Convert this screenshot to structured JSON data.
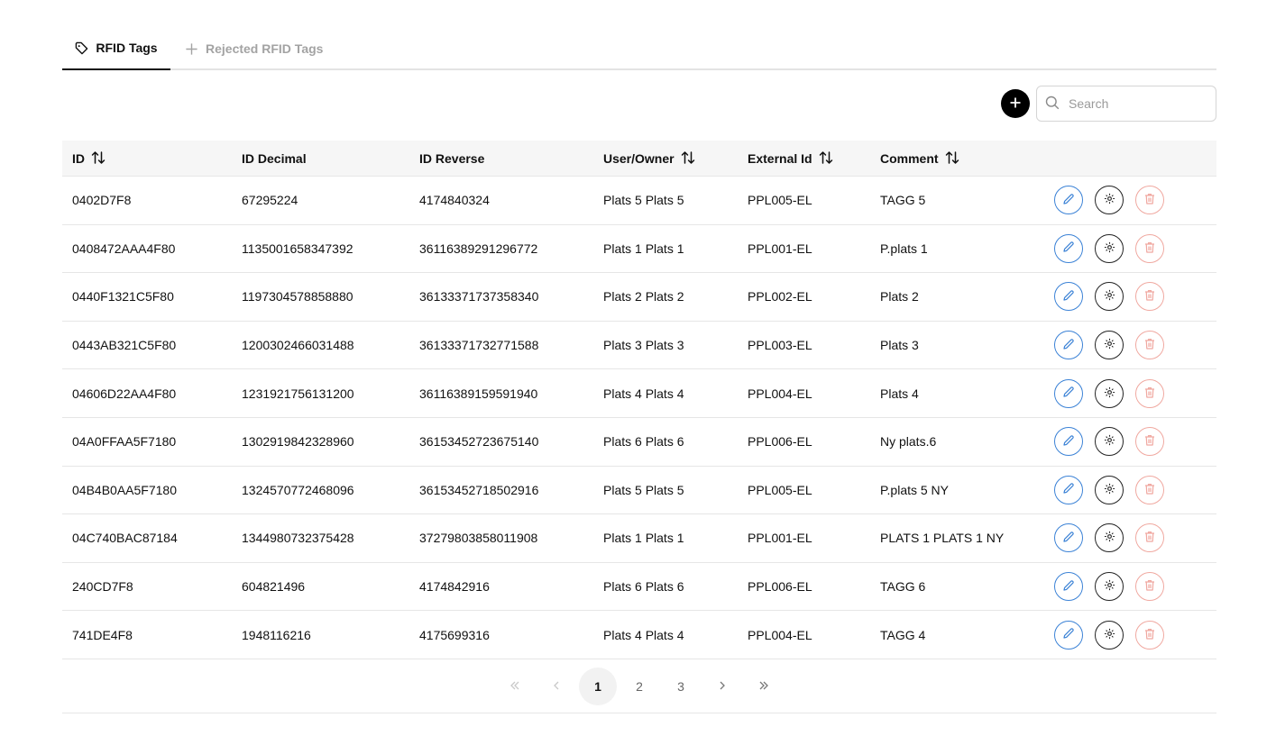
{
  "tabs": [
    {
      "label": "RFID Tags",
      "icon": "tag-icon"
    },
    {
      "label": "Rejected RFID Tags",
      "icon": "plus-icon"
    }
  ],
  "search": {
    "placeholder": "Search"
  },
  "table": {
    "headers": [
      "ID",
      "ID Decimal",
      "ID Reverse",
      "User/Owner",
      "External Id",
      "Comment"
    ],
    "rows": [
      [
        "0402D7F8",
        "67295224",
        "4174840324",
        "Plats 5 Plats 5",
        "PPL005-EL",
        "TAGG 5"
      ],
      [
        "0408472AAA4F80",
        "1135001658347392",
        "36116389291296772",
        "Plats 1 Plats 1",
        "PPL001-EL",
        "P.plats 1"
      ],
      [
        "0440F1321C5F80",
        "1197304578858880",
        "36133371737358340",
        "Plats 2 Plats 2",
        "PPL002-EL",
        "Plats 2"
      ],
      [
        "0443AB321C5F80",
        "1200302466031488",
        "36133371732771588",
        "Plats 3 Plats 3",
        "PPL003-EL",
        "Plats 3"
      ],
      [
        "04606D22AA4F80",
        "1231921756131200",
        "36116389159591940",
        "Plats 4 Plats 4",
        "PPL004-EL",
        "Plats 4"
      ],
      [
        "04A0FFAA5F7180",
        "1302919842328960",
        "36153452723675140",
        "Plats 6 Plats 6",
        "PPL006-EL",
        "Ny plats.6"
      ],
      [
        "04B4B0AA5F7180",
        "1324570772468096",
        "36153452718502916",
        "Plats 5 Plats 5",
        "PPL005-EL",
        "P.plats 5 NY"
      ],
      [
        "04C740BAC87184",
        "1344980732375428",
        "37279803858011908",
        "Plats 1 Plats 1",
        "PPL001-EL",
        "PLATS 1 PLATS 1 NY"
      ],
      [
        "240CD7F8",
        "604821496",
        "4174842916",
        "Plats 6 Plats 6",
        "PPL006-EL",
        "TAGG 6"
      ],
      [
        "741DE4F8",
        "1948116216",
        "4175699316",
        "Plats 4 Plats 4",
        "PPL004-EL",
        "TAGG 4"
      ]
    ]
  },
  "pagination": {
    "first": "«",
    "prev": "‹",
    "pages": [
      "1",
      "2",
      "3"
    ],
    "current": "1",
    "next": "›",
    "last": "»"
  },
  "colors": {
    "edit": "#3b82d6",
    "delete": "#f0a8a0",
    "accent": "#000000"
  }
}
